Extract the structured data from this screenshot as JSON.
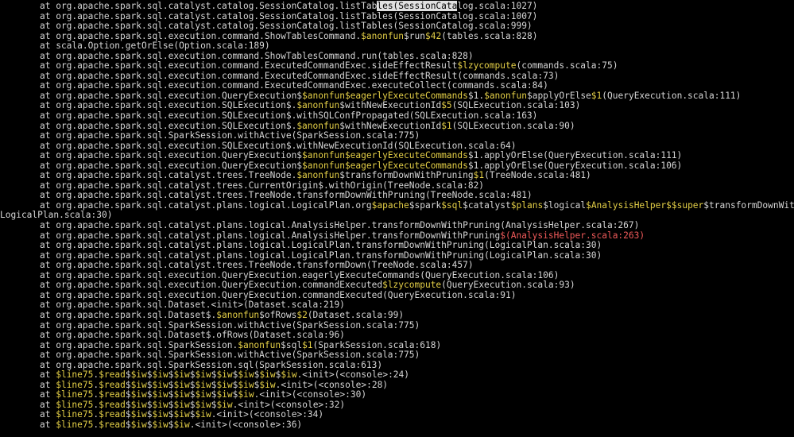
{
  "window": {
    "title": ""
  },
  "colors": {
    "background": "#000000",
    "text": "#d6d6d6",
    "highlight": "#e5d047",
    "error": "#f05a5a",
    "selection": "#e0e0e0"
  },
  "terminal": {
    "lines": [
      {
        "indent": true,
        "segments": [
          [
            "w",
            "at org.apache.spark.sql.catalyst.catalog.SessionCatalog.listTab"
          ],
          [
            "hl",
            "les(SessionCata"
          ],
          [
            "w",
            "log.scala:1027)"
          ]
        ]
      },
      {
        "indent": true,
        "segments": [
          [
            "w",
            "at org.apache.spark.sql.catalyst.catalog.SessionCatalog.listTables(SessionCatalog.scala:1007)"
          ]
        ]
      },
      {
        "indent": true,
        "segments": [
          [
            "w",
            "at org.apache.spark.sql.catalyst.catalog.SessionCatalog.listTables(SessionCatalog.scala:999)"
          ]
        ]
      },
      {
        "indent": true,
        "segments": [
          [
            "w",
            "at org.apache.spark.sql.execution.command.ShowTablesCommand."
          ],
          [
            "y",
            "$anonfun"
          ],
          [
            "w",
            "$run"
          ],
          [
            "y",
            "$42"
          ],
          [
            "w",
            "(tables.scala:828)"
          ]
        ]
      },
      {
        "indent": true,
        "segments": [
          [
            "w",
            "at scala.Option.getOrElse(Option.scala:189)"
          ]
        ]
      },
      {
        "indent": true,
        "segments": [
          [
            "w",
            "at org.apache.spark.sql.execution.command.ShowTablesCommand.run(tables.scala:828)"
          ]
        ]
      },
      {
        "indent": true,
        "segments": [
          [
            "w",
            "at org.apache.spark.sql.execution.command.ExecutedCommandExec.sideEffectResult"
          ],
          [
            "y",
            "$lzycompute"
          ],
          [
            "w",
            "(commands.scala:75)"
          ]
        ]
      },
      {
        "indent": true,
        "segments": [
          [
            "w",
            "at org.apache.spark.sql.execution.command.ExecutedCommandExec.sideEffectResult(commands.scala:73)"
          ]
        ]
      },
      {
        "indent": true,
        "segments": [
          [
            "w",
            "at org.apache.spark.sql.execution.command.ExecutedCommandExec.executeCollect(commands.scala:84)"
          ]
        ]
      },
      {
        "indent": true,
        "segments": [
          [
            "w",
            "at org.apache.spark.sql.execution.QueryExecution$"
          ],
          [
            "y",
            "$anonfun"
          ],
          [
            "y",
            "$eagerlyExecuteCommands"
          ],
          [
            "w",
            "$1."
          ],
          [
            "y",
            "$anonfun"
          ],
          [
            "w",
            "$applyOrElse"
          ],
          [
            "y",
            "$1"
          ],
          [
            "w",
            "(QueryExecution.scala:111)"
          ]
        ]
      },
      {
        "indent": true,
        "segments": [
          [
            "w",
            "at org.apache.spark.sql.execution.SQLExecution$."
          ],
          [
            "y",
            "$anonfun"
          ],
          [
            "w",
            "$withNewExecutionId"
          ],
          [
            "y",
            "$5"
          ],
          [
            "w",
            "(SQLExecution.scala:103)"
          ]
        ]
      },
      {
        "indent": true,
        "segments": [
          [
            "w",
            "at org.apache.spark.sql.execution.SQLExecution$.withSQLConfPropagated(SQLExecution.scala:163)"
          ]
        ]
      },
      {
        "indent": true,
        "segments": [
          [
            "w",
            "at org.apache.spark.sql.execution.SQLExecution$."
          ],
          [
            "y",
            "$anonfun"
          ],
          [
            "w",
            "$withNewExecutionId"
          ],
          [
            "y",
            "$1"
          ],
          [
            "w",
            "(SQLExecution.scala:90)"
          ]
        ]
      },
      {
        "indent": true,
        "segments": [
          [
            "w",
            "at org.apache.spark.sql.SparkSession.withActive(SparkSession.scala:775)"
          ]
        ]
      },
      {
        "indent": true,
        "segments": [
          [
            "w",
            "at org.apache.spark.sql.execution.SQLExecution$.withNewExecutionId(SQLExecution.scala:64)"
          ]
        ]
      },
      {
        "indent": true,
        "segments": [
          [
            "w",
            "at org.apache.spark.sql.execution.QueryExecution$"
          ],
          [
            "y",
            "$anonfun"
          ],
          [
            "y",
            "$eagerlyExecuteCommands"
          ],
          [
            "w",
            "$1.applyOrElse(QueryExecution.scala:111)"
          ]
        ]
      },
      {
        "indent": true,
        "segments": [
          [
            "w",
            "at org.apache.spark.sql.execution.QueryExecution$"
          ],
          [
            "y",
            "$anonfun"
          ],
          [
            "y",
            "$eagerlyExecuteCommands"
          ],
          [
            "w",
            "$1.applyOrElse(QueryExecution.scala:106)"
          ]
        ]
      },
      {
        "indent": true,
        "segments": [
          [
            "w",
            "at org.apache.spark.sql.catalyst.trees.TreeNode."
          ],
          [
            "y",
            "$anonfun"
          ],
          [
            "w",
            "$transformDownWithPruning"
          ],
          [
            "y",
            "$1"
          ],
          [
            "w",
            "(TreeNode.scala:481)"
          ]
        ]
      },
      {
        "indent": true,
        "segments": [
          [
            "w",
            "at org.apache.spark.sql.catalyst.trees.CurrentOrigin$.withOrigin(TreeNode.scala:82)"
          ]
        ]
      },
      {
        "indent": true,
        "segments": [
          [
            "w",
            "at org.apache.spark.sql.catalyst.trees.TreeNode.transformDownWithPruning(TreeNode.scala:481)"
          ]
        ]
      },
      {
        "indent": true,
        "segments": [
          [
            "w",
            "at org.apache.spark.sql.catalyst.plans.logical.LogicalPlan.org"
          ],
          [
            "y",
            "$apache"
          ],
          [
            "w",
            "$spark"
          ],
          [
            "y",
            "$sql"
          ],
          [
            "w",
            "$catalyst"
          ],
          [
            "y",
            "$plans"
          ],
          [
            "w",
            "$logical"
          ],
          [
            "y",
            "$AnalysisHelper"
          ],
          [
            "y",
            "$$super"
          ],
          [
            "w",
            "$transformDownWithPruning("
          ]
        ]
      },
      {
        "indent": false,
        "segments": [
          [
            "w",
            "LogicalPlan.scala:30)"
          ]
        ]
      },
      {
        "indent": true,
        "segments": [
          [
            "w",
            "at org.apache.spark.sql.catalyst.plans.logical.AnalysisHelper.transformDownWithPruning(AnalysisHelper.scala:267)"
          ]
        ]
      },
      {
        "indent": true,
        "segments": [
          [
            "w",
            "at org.apache.spark.sql.catalyst.plans.logical.AnalysisHelper.transformDownWithPruning"
          ],
          [
            "r",
            "$(AnalysisHelper.scala:263)"
          ]
        ]
      },
      {
        "indent": true,
        "segments": [
          [
            "w",
            "at org.apache.spark.sql.catalyst.plans.logical.LogicalPlan.transformDownWithPruning(LogicalPlan.scala:30)"
          ]
        ]
      },
      {
        "indent": true,
        "segments": [
          [
            "w",
            "at org.apache.spark.sql.catalyst.plans.logical.LogicalPlan.transformDownWithPruning(LogicalPlan.scala:30)"
          ]
        ]
      },
      {
        "indent": true,
        "segments": [
          [
            "w",
            "at org.apache.spark.sql.catalyst.trees.TreeNode.transformDown(TreeNode.scala:457)"
          ]
        ]
      },
      {
        "indent": true,
        "segments": [
          [
            "w",
            "at org.apache.spark.sql.execution.QueryExecution.eagerlyExecuteCommands(QueryExecution.scala:106)"
          ]
        ]
      },
      {
        "indent": true,
        "segments": [
          [
            "w",
            "at org.apache.spark.sql.execution.QueryExecution.commandExecuted"
          ],
          [
            "y",
            "$lzycompute"
          ],
          [
            "w",
            "(QueryExecution.scala:93)"
          ]
        ]
      },
      {
        "indent": true,
        "segments": [
          [
            "w",
            "at org.apache.spark.sql.execution.QueryExecution.commandExecuted(QueryExecution.scala:91)"
          ]
        ]
      },
      {
        "indent": true,
        "segments": [
          [
            "w",
            "at org.apache.spark.sql.Dataset.<init>(Dataset.scala:219)"
          ]
        ]
      },
      {
        "indent": true,
        "segments": [
          [
            "w",
            "at org.apache.spark.sql.Dataset$."
          ],
          [
            "y",
            "$anonfun"
          ],
          [
            "w",
            "$ofRows"
          ],
          [
            "y",
            "$2"
          ],
          [
            "w",
            "(Dataset.scala:99)"
          ]
        ]
      },
      {
        "indent": true,
        "segments": [
          [
            "w",
            "at org.apache.spark.sql.SparkSession.withActive(SparkSession.scala:775)"
          ]
        ]
      },
      {
        "indent": true,
        "segments": [
          [
            "w",
            "at org.apache.spark.sql.Dataset$.ofRows(Dataset.scala:96)"
          ]
        ]
      },
      {
        "indent": true,
        "segments": [
          [
            "w",
            "at org.apache.spark.sql.SparkSession."
          ],
          [
            "y",
            "$anonfun"
          ],
          [
            "w",
            "$sql"
          ],
          [
            "y",
            "$1"
          ],
          [
            "w",
            "(SparkSession.scala:618)"
          ]
        ]
      },
      {
        "indent": true,
        "segments": [
          [
            "w",
            "at org.apache.spark.sql.SparkSession.withActive(SparkSession.scala:775)"
          ]
        ]
      },
      {
        "indent": true,
        "segments": [
          [
            "w",
            "at org.apache.spark.sql.SparkSession.sql(SparkSession.scala:613)"
          ]
        ]
      },
      {
        "indent": true,
        "segments": [
          [
            "w",
            "at "
          ],
          [
            "y",
            "$line75"
          ],
          [
            "w",
            "."
          ],
          [
            "y",
            "$read"
          ],
          [
            "w",
            "$"
          ],
          [
            "y",
            "$iw"
          ],
          [
            "w",
            "$"
          ],
          [
            "y",
            "$iw"
          ],
          [
            "w",
            "$"
          ],
          [
            "y",
            "$iw"
          ],
          [
            "w",
            "$"
          ],
          [
            "y",
            "$iw"
          ],
          [
            "w",
            "$"
          ],
          [
            "y",
            "$iw"
          ],
          [
            "w",
            "$"
          ],
          [
            "y",
            "$iw"
          ],
          [
            "w",
            "$"
          ],
          [
            "y",
            "$iw"
          ],
          [
            "w",
            "$"
          ],
          [
            "y",
            "$iw"
          ],
          [
            "w",
            ".<init>(<console>:24)"
          ]
        ]
      },
      {
        "indent": true,
        "segments": [
          [
            "w",
            "at "
          ],
          [
            "y",
            "$line75"
          ],
          [
            "w",
            "."
          ],
          [
            "y",
            "$read"
          ],
          [
            "w",
            "$"
          ],
          [
            "y",
            "$iw"
          ],
          [
            "w",
            "$"
          ],
          [
            "y",
            "$iw"
          ],
          [
            "w",
            "$"
          ],
          [
            "y",
            "$iw"
          ],
          [
            "w",
            "$"
          ],
          [
            "y",
            "$iw"
          ],
          [
            "w",
            "$"
          ],
          [
            "y",
            "$iw"
          ],
          [
            "w",
            "$"
          ],
          [
            "y",
            "$iw"
          ],
          [
            "w",
            "$"
          ],
          [
            "y",
            "$iw"
          ],
          [
            "w",
            ".<init>(<console>:28)"
          ]
        ]
      },
      {
        "indent": true,
        "segments": [
          [
            "w",
            "at "
          ],
          [
            "y",
            "$line75"
          ],
          [
            "w",
            "."
          ],
          [
            "y",
            "$read"
          ],
          [
            "w",
            "$"
          ],
          [
            "y",
            "$iw"
          ],
          [
            "w",
            "$"
          ],
          [
            "y",
            "$iw"
          ],
          [
            "w",
            "$"
          ],
          [
            "y",
            "$iw"
          ],
          [
            "w",
            "$"
          ],
          [
            "y",
            "$iw"
          ],
          [
            "w",
            "$"
          ],
          [
            "y",
            "$iw"
          ],
          [
            "w",
            "$"
          ],
          [
            "y",
            "$iw"
          ],
          [
            "w",
            ".<init>(<console>:30)"
          ]
        ]
      },
      {
        "indent": true,
        "segments": [
          [
            "w",
            "at "
          ],
          [
            "y",
            "$line75"
          ],
          [
            "w",
            "."
          ],
          [
            "y",
            "$read"
          ],
          [
            "w",
            "$"
          ],
          [
            "y",
            "$iw"
          ],
          [
            "w",
            "$"
          ],
          [
            "y",
            "$iw"
          ],
          [
            "w",
            "$"
          ],
          [
            "y",
            "$iw"
          ],
          [
            "w",
            "$"
          ],
          [
            "y",
            "$iw"
          ],
          [
            "w",
            "$"
          ],
          [
            "y",
            "$iw"
          ],
          [
            "w",
            ".<init>(<console>:32)"
          ]
        ]
      },
      {
        "indent": true,
        "segments": [
          [
            "w",
            "at "
          ],
          [
            "y",
            "$line75"
          ],
          [
            "w",
            "."
          ],
          [
            "y",
            "$read"
          ],
          [
            "w",
            "$"
          ],
          [
            "y",
            "$iw"
          ],
          [
            "w",
            "$"
          ],
          [
            "y",
            "$iw"
          ],
          [
            "w",
            "$"
          ],
          [
            "y",
            "$iw"
          ],
          [
            "w",
            "$"
          ],
          [
            "y",
            "$iw"
          ],
          [
            "w",
            ".<init>(<console>:34)"
          ]
        ]
      },
      {
        "indent": true,
        "segments": [
          [
            "w",
            "at "
          ],
          [
            "y",
            "$line75"
          ],
          [
            "w",
            "."
          ],
          [
            "y",
            "$read"
          ],
          [
            "w",
            "$"
          ],
          [
            "y",
            "$iw"
          ],
          [
            "w",
            "$"
          ],
          [
            "y",
            "$iw"
          ],
          [
            "w",
            "$"
          ],
          [
            "y",
            "$iw"
          ],
          [
            "w",
            ".<init>(<console>:36)"
          ]
        ]
      }
    ]
  }
}
